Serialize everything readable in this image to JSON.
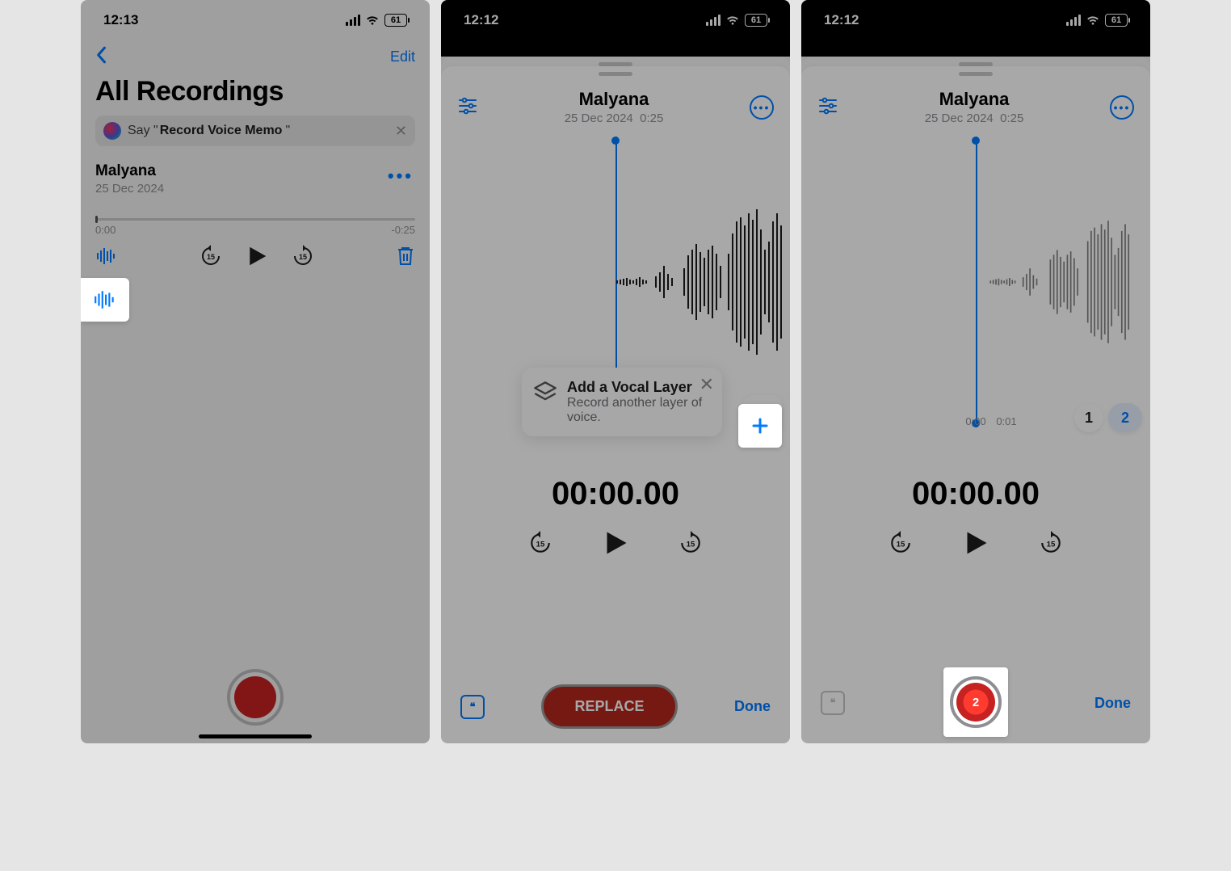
{
  "screen1": {
    "status": {
      "time": "12:13",
      "battery": "61"
    },
    "nav": {
      "edit": "Edit"
    },
    "title": "All Recordings",
    "siri": {
      "prefix": "Say \"",
      "phrase": "Record Voice Memo",
      "suffix": "\""
    },
    "recording": {
      "title": "Malyana",
      "date": "25 Dec 2024",
      "start": "0:00",
      "end": "-0:25"
    }
  },
  "screen2": {
    "status": {
      "time": "12:12",
      "battery": "61"
    },
    "rec": {
      "name": "Malyana",
      "date": "25 Dec 2024",
      "duration": "0:25"
    },
    "tooltip": {
      "title": "Add a Vocal Layer",
      "sub": "Record another layer of voice."
    },
    "timer": "00:00.00",
    "replace": "REPLACE",
    "done": "Done"
  },
  "screen3": {
    "status": {
      "time": "12:12",
      "battery": "61"
    },
    "rec": {
      "name": "Malyana",
      "date": "25 Dec 2024",
      "duration": "0:25"
    },
    "layers": {
      "a": "1",
      "b": "2"
    },
    "timeline": {
      "t0": "0:00",
      "t1": "0:01"
    },
    "timer": "00:00.00",
    "recordCount": "2",
    "done": "Done"
  },
  "icons": {
    "skipText": "15"
  }
}
